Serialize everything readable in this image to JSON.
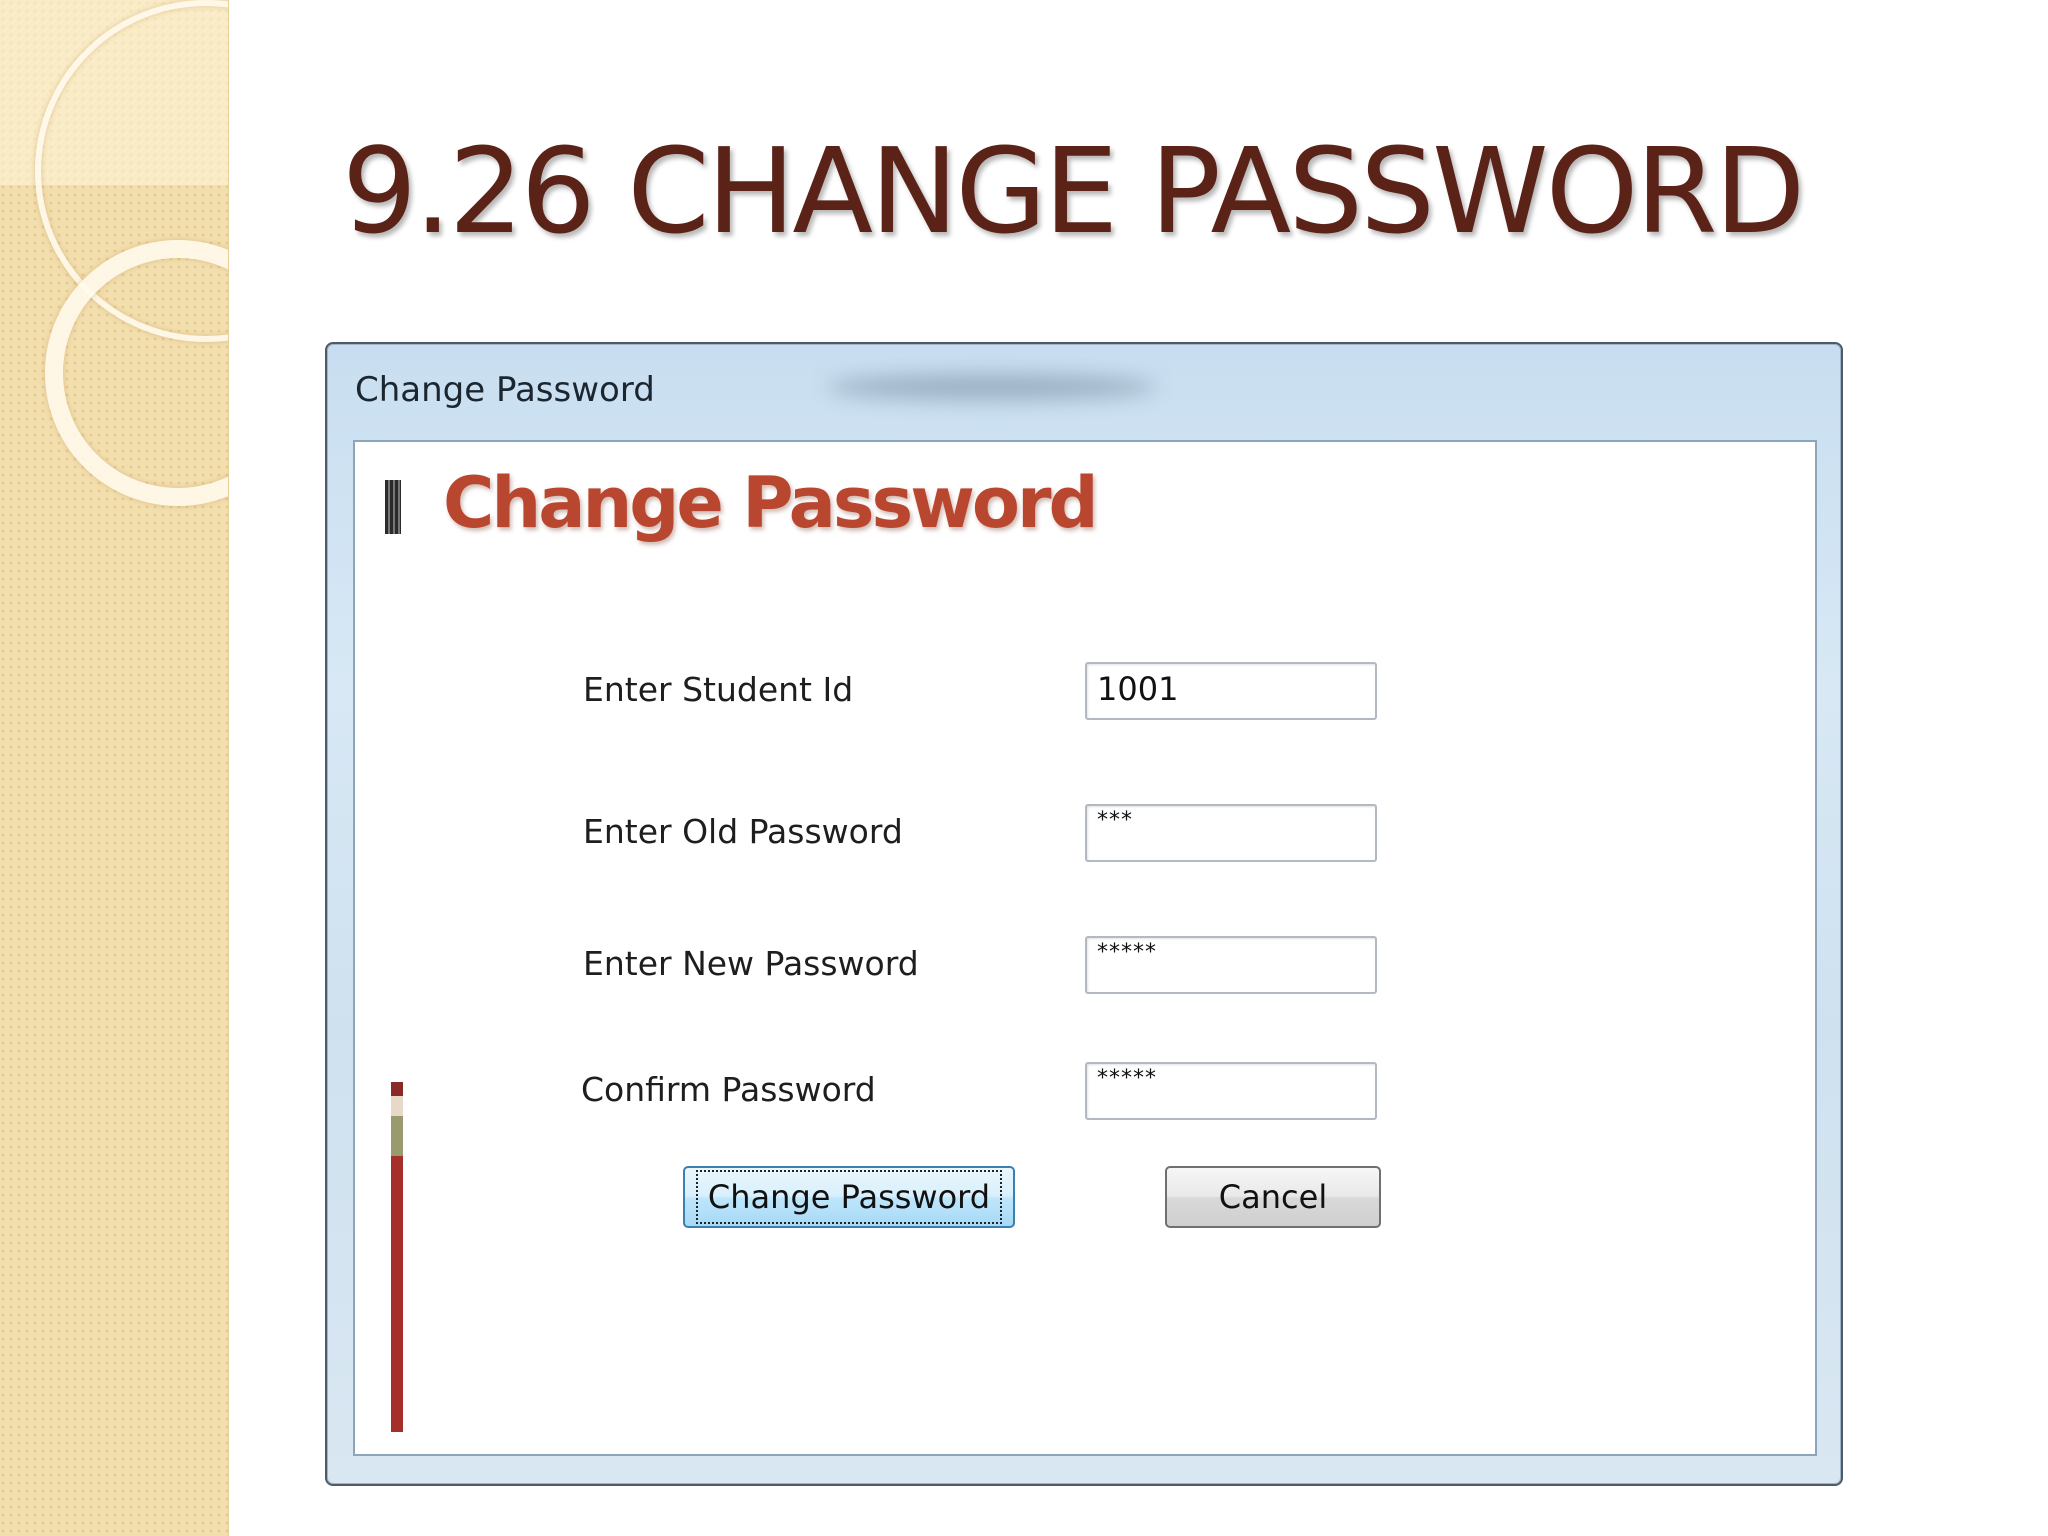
{
  "slide": {
    "title": "9.26 CHANGE PASSWORD"
  },
  "window": {
    "title": "Change Password",
    "heading": "Change Password"
  },
  "form": {
    "student_id": {
      "label": "Enter Student Id",
      "value": "1001"
    },
    "old_password": {
      "label": "Enter Old Password",
      "value": "***"
    },
    "new_password": {
      "label": "Enter New Password",
      "value": "*****"
    },
    "confirm_password": {
      "label": "Confirm Password",
      "value": "*****"
    }
  },
  "buttons": {
    "change_password": "Change Password",
    "cancel": "Cancel"
  },
  "colors": {
    "title": "#5b2217",
    "heading": "#b9472f",
    "side_strip": "#f3dfae",
    "accent_bar": "#a52f2a"
  }
}
